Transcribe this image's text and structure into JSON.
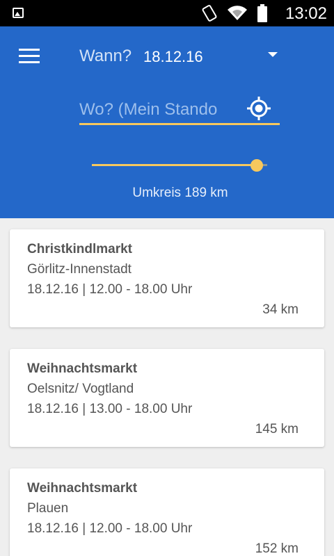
{
  "status_bar": {
    "time": "13:02",
    "icons": [
      "image-notification-icon",
      "vibrate-icon",
      "wifi-icon",
      "battery-icon"
    ]
  },
  "header": {
    "background_color": "#2468c9",
    "accent_color": "#f7c85e",
    "when_label": "Wann?",
    "when_value": "18.12.16",
    "where_placeholder": "Wo? (Mein Stando",
    "radius_value": 0.94,
    "radius_label": "Umkreis 189 km"
  },
  "events": [
    {
      "title": "Christkindlmarkt",
      "place": "Görlitz-Innenstadt",
      "datetime": "18.12.16 | 12.00 - 18.00 Uhr",
      "distance": "34 km"
    },
    {
      "title": "Weihnachtsmarkt",
      "place": "Oelsnitz/ Vogtland",
      "datetime": "18.12.16 | 13.00 - 18.00 Uhr",
      "distance": "145 km"
    },
    {
      "title": "Weihnachtsmarkt",
      "place": "Plauen",
      "datetime": "18.12.16 | 12.00 - 18.00 Uhr",
      "distance": "152 km"
    }
  ]
}
